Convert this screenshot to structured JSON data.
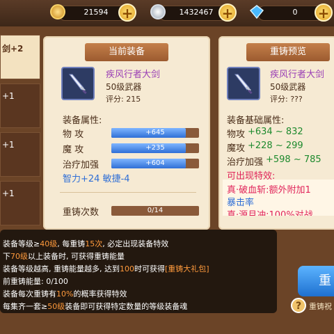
{
  "currency": {
    "gold": "21594",
    "silver": "1432467",
    "diamond": "0",
    "plus_symbol": "+"
  },
  "left_list": {
    "items": [
      {
        "label": "剑+2"
      },
      {
        "label": "+1"
      },
      {
        "label": "+1"
      },
      {
        "label": "+1"
      }
    ]
  },
  "current_equip": {
    "title": "当前装备",
    "item_name": "疾风行者大剑",
    "item_type": "50级武器",
    "score": "评分: 215",
    "attr_title": "装备属性:",
    "attrs": [
      {
        "name": "物    攻",
        "value": "+645",
        "fill": 0.85
      },
      {
        "name": "魔    攻",
        "value": "+235",
        "fill": 0.85
      },
      {
        "name": "治疗加强",
        "value": "+604",
        "fill": 0.85
      }
    ],
    "extra_attrs": "智力+24  敏捷-4",
    "reforge_label": "重铸次数",
    "reforge_value": "0/14",
    "reforge_fill": 0
  },
  "preview": {
    "title": "重铸预览",
    "item_name": "疾风行者大剑",
    "item_type": "50级武器",
    "score": "评分: ???",
    "attr_title": "装备基础属性:",
    "attrs": [
      {
        "name": "物攻",
        "value": "+634 ~ 832"
      },
      {
        "name": "魔攻",
        "value": "+228 ~ 299"
      },
      {
        "name": "治疗加强",
        "value": "+598 ~ 785"
      }
    ],
    "possible_title": "可出现特效:",
    "effects": [
      "真·破血斩:额外附加1",
      "暴击率",
      "真·源月冲:100%对战"
    ]
  },
  "tooltip": {
    "lines": [
      {
        "pre": "装备等级≥",
        "h1": "40级",
        "mid": ", 每重铸",
        "h2": "15次",
        "post": ", 必定出现装备特效"
      },
      {
        "pre": "下",
        "h1": "70级",
        "mid": "以上装备时, 可获得重铸能量",
        "h2": "",
        "post": ""
      },
      {
        "pre": "装备等级越高, 重铸能量越多, 达到",
        "h1": "100",
        "mid": "时可获得",
        "h2": "[重铸大礼包]",
        "post": ""
      },
      {
        "pre": "前重铸能量: 0/100",
        "h1": "",
        "mid": "",
        "h2": "",
        "post": ""
      },
      {
        "pre": "装备每次重铸有",
        "h1": "10%",
        "mid": "的概率获得特效",
        "h2": "",
        "post": ""
      },
      {
        "pre": "每集齐一套≥",
        "h1": "50级",
        "mid": "装备即可获得特定数量的等级装备魂",
        "h2": "",
        "post": ""
      }
    ]
  },
  "buttons": {
    "reforge": "重",
    "reforge_blessing": "重铸祝",
    "help": "?"
  },
  "colors": {
    "accent_blue": "#2f6fd6",
    "highlight_orange": "#ff9a3c",
    "purple_name": "#9a3fb5",
    "green_value": "#1e8a2e",
    "red_effect": "#e0245a"
  }
}
